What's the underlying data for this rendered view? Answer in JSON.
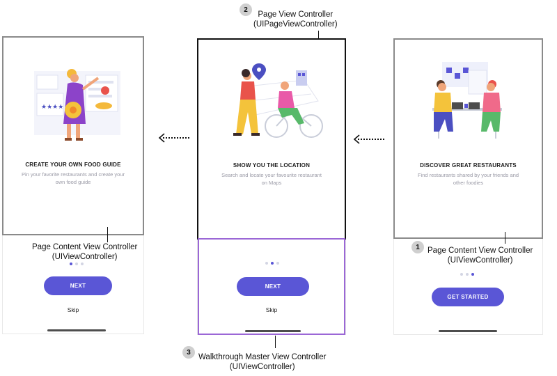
{
  "pages": [
    {
      "title": "CREATE YOUR OWN FOOD GUIDE",
      "desc_line1": "Pin your favorite restaurants and create your",
      "desc_line2": "own food guide",
      "button": "NEXT",
      "skip": "Skip",
      "active_dot": 1,
      "illustration": "food-guide-illustration"
    },
    {
      "title": "SHOW YOU THE LOCATION",
      "desc_line1": "Search and locate your favourite restaurant",
      "desc_line2": "on Maps",
      "button": "NEXT",
      "skip": "Skip",
      "active_dot": 2,
      "illustration": "location-illustration"
    },
    {
      "title": "DISCOVER GREAT RESTAURANTS",
      "desc_line1": "Find restaurants shared by your friends and",
      "desc_line2": "other foodies",
      "button": "GET STARTED",
      "active_dot": 3,
      "illustration": "restaurants-illustration"
    }
  ],
  "callouts": [
    {
      "number": "2",
      "line1": "Page View Controller",
      "line2": "(UIPageViewController)"
    },
    {
      "number": "",
      "line1": "Page Content View Controller",
      "line2": "(UIViewController)"
    },
    {
      "number": "1",
      "line1": "Page Content View Controller",
      "line2": "(UIViewController)"
    },
    {
      "number": "3",
      "line1": "Walkthrough Master View Controller",
      "line2": "(UIViewController)"
    }
  ],
  "colors": {
    "accent": "#5a56d6",
    "page_frame": "#8a8a8a",
    "page_view_frame": "#111111",
    "master_frame": "#9b67d6",
    "callout_badge": "#cfcfcf"
  }
}
